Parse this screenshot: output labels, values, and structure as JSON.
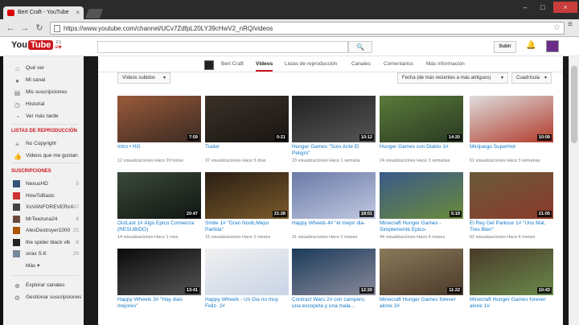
{
  "browser": {
    "tab_title": "Bert Craft - YouTube",
    "tab_close": "×",
    "url": "https://www.youtube.com/channel/UCv7ZdfpL20LY39cHwV2_nRQ/videos",
    "back": "←",
    "forward": "→",
    "reload": "↻",
    "star": "☆",
    "menu": "≡",
    "win_min": "–",
    "win_max": "□",
    "win_close": "×"
  },
  "masthead": {
    "logo_you": "You",
    "logo_tube": "Tube",
    "logo_country": "ES",
    "guide": "≡▾",
    "search_icon": "🔍",
    "upload": "Subir",
    "bell": "🔔"
  },
  "sidebar": {
    "nav": [
      {
        "label": "Qué ver",
        "icon": "⌂"
      },
      {
        "label": "Mi canal",
        "icon": "●"
      },
      {
        "label": "Mis suscripciones",
        "icon": "▤"
      },
      {
        "label": "Historial",
        "icon": "◷"
      },
      {
        "label": "Ver más tarde",
        "icon": "◔"
      }
    ],
    "playlists_header": "LISTAS DE REPRODUCCIÓN",
    "playlists": [
      {
        "label": "No Copyright",
        "icon": "≡"
      },
      {
        "label": "Videos que me gustan",
        "icon": "👍"
      }
    ],
    "subs_header": "SUSCRIPCIONES",
    "subscriptions": [
      {
        "label": "NexusHD",
        "count": "5",
        "color": "#335577"
      },
      {
        "label": "HowToBasic",
        "count": "",
        "color": "#cc3333"
      },
      {
        "label": "XxVANFOREVERxX",
        "count": "47",
        "color": "#444444"
      },
      {
        "label": "MrTeezuna24",
        "count": "8",
        "color": "#6a4a3a"
      },
      {
        "label": "AlexDestroyer1000",
        "count": "25",
        "color": "#aa5500"
      },
      {
        "label": "the spider black vlk",
        "count": "8",
        "color": "#222222"
      },
      {
        "label": "sirax S.K",
        "count": "29",
        "color": "#778899"
      }
    ],
    "more": "Más ▾",
    "footer": [
      {
        "label": "Explorar canales",
        "icon": "⊕"
      },
      {
        "label": "Gestionar suscripciones",
        "icon": "⚙"
      }
    ]
  },
  "channel": {
    "name": "Bert Craft",
    "tabs": [
      "Vídeos",
      "Listas de reproducción",
      "Canales",
      "Comentarios",
      "Más información"
    ],
    "active_tab": "Vídeos",
    "filter_uploaded": "Vídeos subidos",
    "sort": "Fecha (de más recientes a más antiguos)",
    "view": "Cuadrícula"
  },
  "videos": [
    {
      "title": "Intro • HG",
      "views": "12 visualizaciones",
      "age": "Hace 20 horas",
      "duration": "7:59",
      "c1": "#9a5a3a",
      "c2": "#3a2a22"
    },
    {
      "title": "Trailer",
      "views": "37 visualizaciones",
      "age": "Hace 5 días",
      "duration": "0:21",
      "c1": "#3a3028",
      "c2": "#1a1612"
    },
    {
      "title": "Hunger Games \"Solo Ante El Peligro\"",
      "views": "23 visualizaciones",
      "age": "Hace 1 semana",
      "duration": "10:12",
      "c1": "#222222",
      "c2": "#555555"
    },
    {
      "title": "Hunger Games con Diablo 1#",
      "views": "24 visualizaciones",
      "age": "Hace 3 semanas",
      "duration": "14:20",
      "c1": "#5a7a3a",
      "c2": "#2a3a22"
    },
    {
      "title": "Minijuego SuperHot",
      "views": "51 visualizaciones",
      "age": "Hace 3 semanas",
      "duration": "10:09",
      "c1": "#dddddd",
      "c2": "#b23a2a"
    },
    {
      "title": "OutLast 1# Algo Epico Comienza (RESUBIDO)",
      "views": "14 visualizaciones",
      "age": "Hace 1 mes",
      "duration": "20:47",
      "c1": "#3a4a3a",
      "c2": "#111511"
    },
    {
      "title": "Smite 1# \"Gran Noob,Mejor Partida\"",
      "views": "15 visualizaciones",
      "age": "Hace 2 meses",
      "duration": "21:28",
      "c1": "#2a1e14",
      "c2": "#7a5a2a"
    },
    {
      "title": "Happy Wheels 4# \"el mejor dia-",
      "views": "31 visualizaciones",
      "age": "Hace 2 meses",
      "duration": "18:01",
      "c1": "#6a7aa8",
      "c2": "#c0c8e0"
    },
    {
      "title": "Minecraft Hunger Games - Simplemente Epico-",
      "views": "44 visualizaciones",
      "age": "Hace 4 meses",
      "duration": "5:19",
      "c1": "#3a5a8a",
      "c2": "#6a8a3a"
    },
    {
      "title": "El Rey Del Parkour 1# \"Uno Mal, Tres Bien\"",
      "views": "62 visualizaciones",
      "age": "Hace 4 meses",
      "duration": "21:05",
      "c1": "#6a5a3a",
      "c2": "#8a3a2a"
    },
    {
      "title": "Happy Wheels 3# \"Hay dias mejores\"",
      "views": "",
      "age": "",
      "duration": "13:41",
      "c1": "#0a0a0a",
      "c2": "#555555"
    },
    {
      "title": "Happy Wheels - Un Dia no muy Feliz- 2#",
      "views": "",
      "age": "",
      "duration": "",
      "c1": "#f0f0f0",
      "c2": "#c9d4e6"
    },
    {
      "title": "Contract Wars 2# con campero, una escopeta y una mala...",
      "views": "",
      "age": "",
      "duration": "12:20",
      "c1": "#1a3a5a",
      "c2": "#8a8a9a"
    },
    {
      "title": "Minecraft Hunger Games forever alone 2#",
      "views": "",
      "age": "",
      "duration": "11:22",
      "c1": "#8a7a5a",
      "c2": "#4a3a2a"
    },
    {
      "title": "Minecraft Hunger Games forever alone 1#",
      "views": "",
      "age": "",
      "duration": "10:43",
      "c1": "#4a3a2a",
      "c2": "#6a8a4a"
    }
  ]
}
